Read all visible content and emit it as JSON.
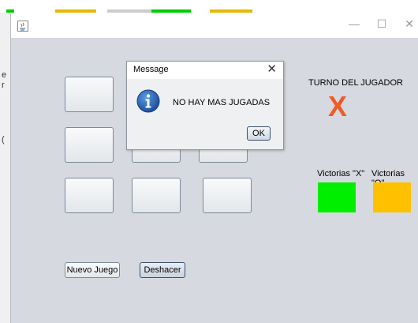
{
  "colors": {
    "x_mark": "#f15a24",
    "victorias_x": "#00ee00",
    "victorias_o": "#ffc000",
    "taskbar": [
      "#00cc00",
      "#e6b800",
      "#cccccc",
      "#cccccc",
      "#00cc00",
      "#e6b800"
    ]
  },
  "window": {
    "controls": {
      "minimize": "—",
      "maximize": "☐",
      "close": "✕"
    }
  },
  "background_fragments": [
    "e",
    "r",
    "("
  ],
  "dialog": {
    "title": "Message",
    "close": "✕",
    "message": "NO HAY MAS JUGADAS",
    "ok_label": "OK",
    "icon": "info-icon"
  },
  "game": {
    "turn_label": "TURNO DEL JUGADOR",
    "turn_mark": "X",
    "wins_x_label": "Victorias \"X\"",
    "wins_o_label": "Victorias \"O\"",
    "new_game_label": "Nuevo Juego",
    "undo_label": "Deshacer",
    "board": [
      "",
      "",
      "",
      "",
      "",
      "",
      "",
      "",
      ""
    ]
  }
}
